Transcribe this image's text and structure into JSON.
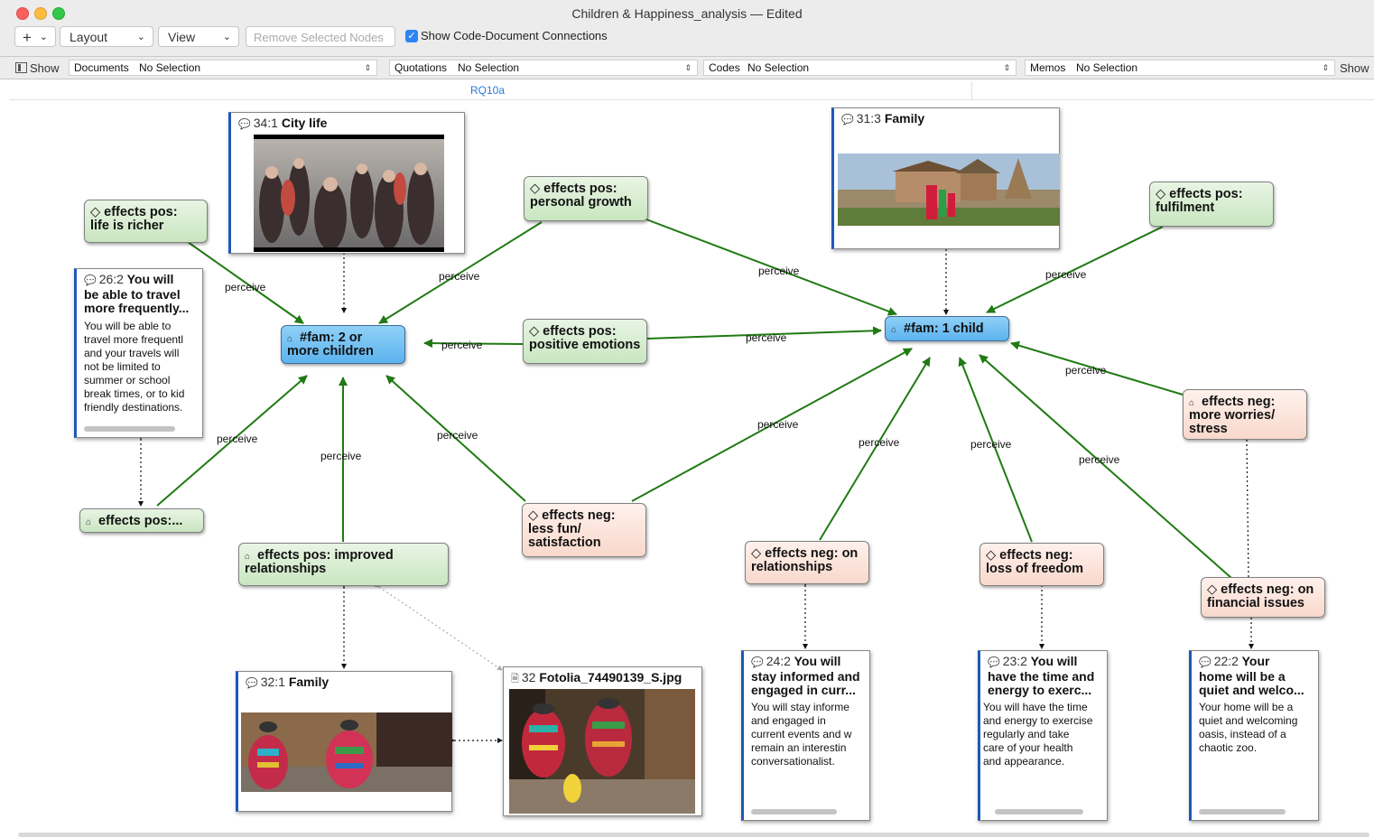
{
  "window": {
    "title": "Children & Happiness_analysis — Edited"
  },
  "toolbar": {
    "add_label": "+",
    "layout_label": "Layout",
    "view_label": "View",
    "remove_label": "Remove Selected Nodes",
    "show_connections_label": "Show Code-Document Connections",
    "show_connections_checked": true
  },
  "filterbar": {
    "show_label": "Show",
    "documents": {
      "key": "Documents",
      "value": "No Selection"
    },
    "quotations": {
      "key": "Quotations",
      "value": "No Selection"
    },
    "codes": {
      "key": "Codes",
      "value": "No Selection"
    },
    "memos": {
      "key": "Memos",
      "value": "No Selection"
    },
    "right_show_label": "Show"
  },
  "view_tab": "RQ10a",
  "nodes": {
    "fam2": {
      "line1": "#fam: 2 or",
      "line2": "more  children"
    },
    "fam1": {
      "line1": "#fam: 1 child"
    },
    "richer": {
      "line1": "effects pos:",
      "line2": "life is richer"
    },
    "growth": {
      "line1": "effects pos:",
      "line2": "personal growth"
    },
    "positive": {
      "line1": "effects pos:",
      "line2": "positive emotions"
    },
    "fulfilment": {
      "line1": "effects pos:",
      "line2": "fulfilment"
    },
    "pos_ellipsis": {
      "line1": "effects pos:..."
    },
    "improved": {
      "line1": "effects pos: improved",
      "line2": "relationships"
    },
    "lessfun": {
      "line1": "effects neg:",
      "line2": "less fun/",
      "line3": "satisfaction"
    },
    "onrel": {
      "line1": "effects neg: on",
      "line2": "relationships"
    },
    "freedom": {
      "line1": "effects neg:",
      "line2": "loss of freedom"
    },
    "financial": {
      "line1": "effects neg: on",
      "line2": "financial issues"
    },
    "worries": {
      "line1": "effects neg:",
      "line2": "more worries/",
      "line3": "stress"
    }
  },
  "cards": {
    "city": {
      "ref": "34:1",
      "title": "City life"
    },
    "family313": {
      "ref": "31:3",
      "title": "Family"
    },
    "travel": {
      "ref": "26:2",
      "title1": "You will",
      "title2": "be able to travel",
      "title3": "more frequently...",
      "body": [
        "You will be able to",
        "travel more frequentl",
        "and your travels will",
        "not be limited to",
        "summer or school",
        "break times, or to kid",
        "friendly destinations."
      ]
    },
    "family321": {
      "ref": "32:1",
      "title": "Family"
    },
    "fotolia": {
      "ref": "32",
      "title": "Fotolia_74490139_S.jpg"
    },
    "informed": {
      "ref": "24:2",
      "title1": "You will",
      "title2": "stay informed and",
      "title3": "engaged in curr...",
      "body": [
        "You will stay informe",
        "and engaged in",
        "current events and w",
        "remain an interestin",
        "conversationalist."
      ]
    },
    "time": {
      "ref": "23:2",
      "title1": "You will",
      "title2": "have the time and",
      "title3": "energy to exerc...",
      "body": [
        "You will have the time",
        "and energy to exercise",
        "regularly and take",
        "care of your health",
        "and appearance."
      ]
    },
    "home": {
      "ref": "22:2",
      "title1": "Your",
      "title2": "home will be a",
      "title3": "quiet and welco...",
      "body": [
        "Your home will be a",
        "quiet and welcoming",
        "oasis, instead of a",
        "chaotic zoo."
      ]
    }
  },
  "edge_label": "perceive",
  "colors": {
    "arrow": "#1f7a12",
    "code_green": "#cfe8c7",
    "code_pink": "#fbdcd0",
    "code_blue": "#66baf0",
    "accent": "#2f84f5"
  }
}
